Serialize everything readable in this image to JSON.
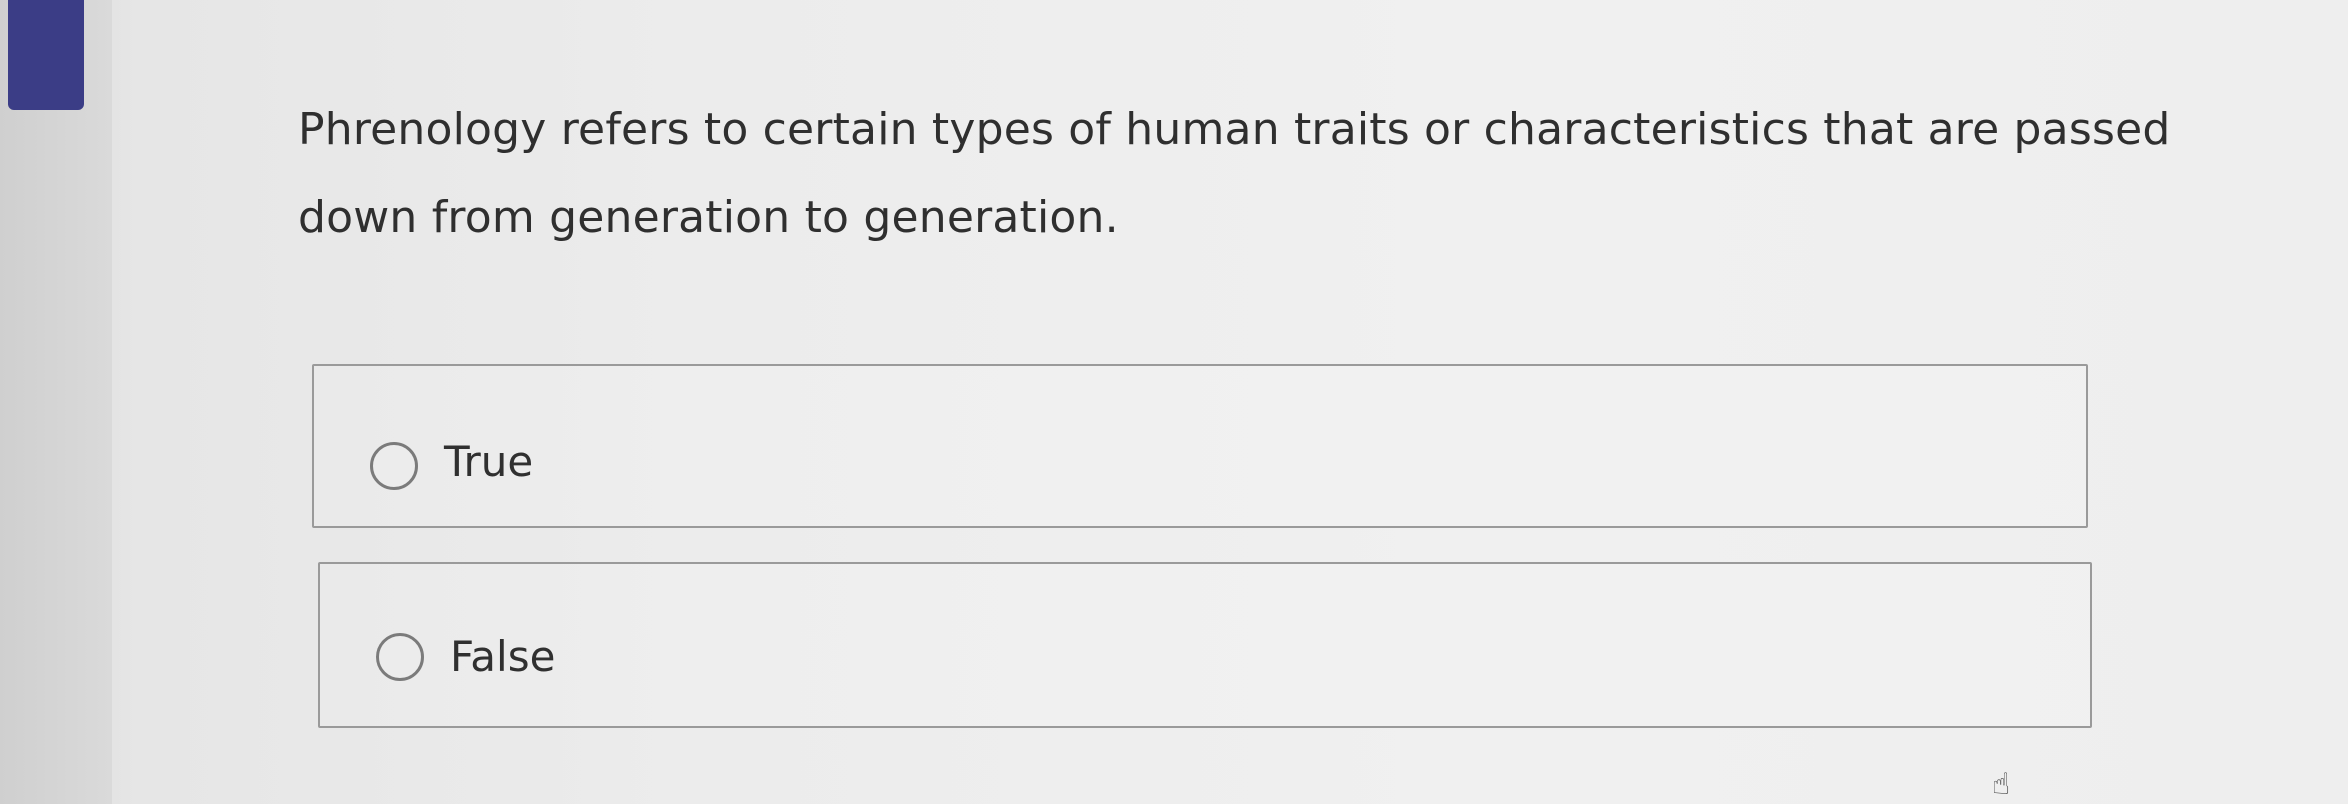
{
  "colors": {
    "accent": "#3b3d86",
    "background": "#ececec",
    "text": "#2f2f2f",
    "border": "#9a9a9a"
  },
  "question": {
    "text": "Phrenology refers to certain types of human traits or characteristics that are passed down from generation to generation."
  },
  "options": [
    {
      "label": "True",
      "selected": false,
      "icon": "radio-icon"
    },
    {
      "label": "False",
      "selected": false,
      "icon": "radio-icon"
    }
  ],
  "cursor": {
    "icon": "hand-cursor-icon"
  }
}
